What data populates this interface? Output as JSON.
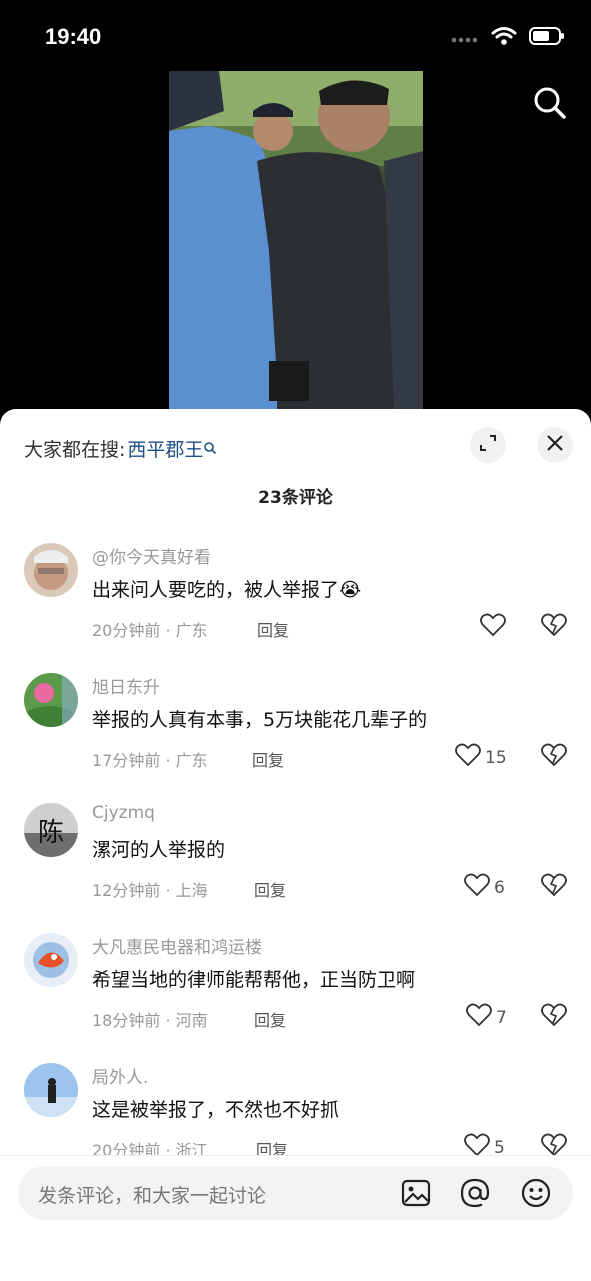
{
  "status_bar": {
    "time": "19:40"
  },
  "sheet": {
    "search_prefix": "大家都在搜:",
    "search_keyword": "西平郡王",
    "comment_count": "23条评论"
  },
  "comments": [
    {
      "user": "@你今天真好看",
      "text": "出来问人要吃的，被人举报了",
      "emoji": "😭",
      "meta": "20分钟前 · 广东",
      "reply": "回复",
      "likes": ""
    },
    {
      "user": "旭日东升",
      "text": "举报的人真有本事，5万块能花几辈子的",
      "meta": "17分钟前 · 广东",
      "reply": "回复",
      "likes": "15"
    },
    {
      "user": "Cjyzmq",
      "text": "漯河的人举报的",
      "meta": "12分钟前 · 上海",
      "reply": "回复",
      "likes": "6"
    },
    {
      "user": "大凡惠民电器和鸿运楼",
      "text": "希望当地的律师能帮帮他，正当防卫啊",
      "meta": "18分钟前 · 河南",
      "reply": "回复",
      "likes": "7"
    },
    {
      "user": "局外人.",
      "text": "这是被举报了，不然也不好抓",
      "meta": "20分钟前 · 浙江",
      "reply": "回复",
      "likes": "5"
    }
  ],
  "input": {
    "placeholder": "发条评论，和大家一起讨论"
  },
  "avatar_seal_char": "陈",
  "colors": {
    "keyword": "#1e4f86",
    "sheet_bg": "#ffffff",
    "muted": "#999999"
  }
}
